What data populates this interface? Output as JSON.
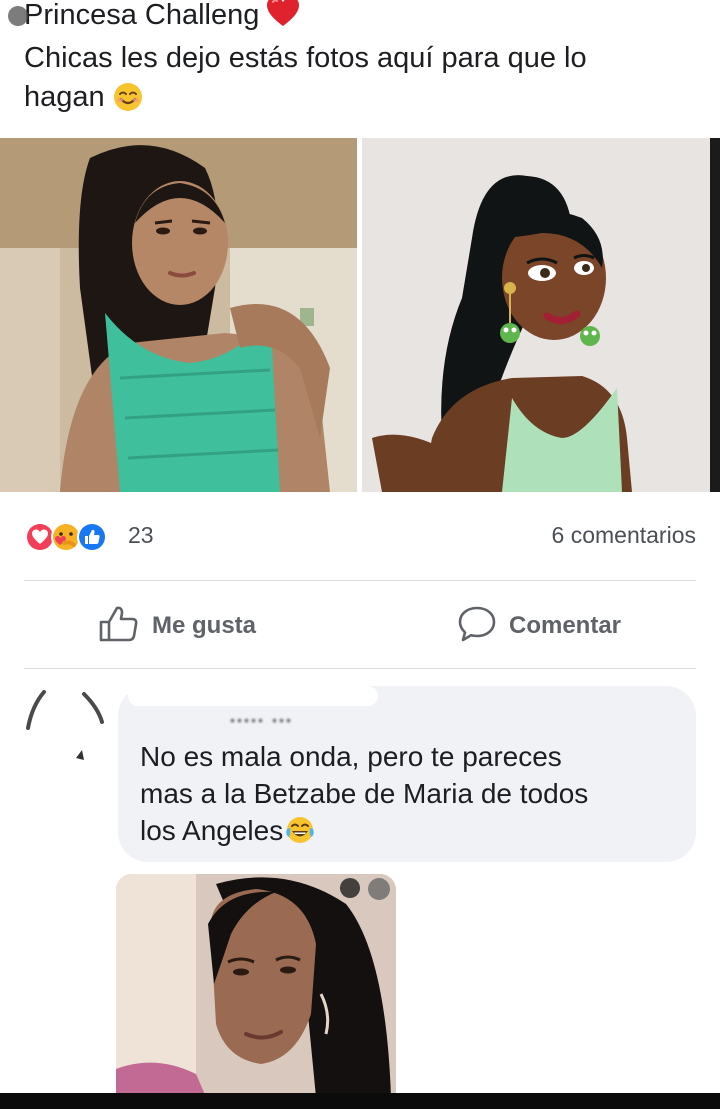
{
  "post": {
    "title_line": "Princesa Challeng",
    "title_emoji": "red-heart-icon",
    "body_line_1": "Chicas les dejo estás fotos aquí para que lo",
    "body_line_2": "hagan",
    "body_emoji": "smiling-face-icon"
  },
  "photos": {
    "left": "photo-real-girl",
    "right": "photo-cartoon-princess"
  },
  "reactions": {
    "icons": [
      "love-reaction-icon",
      "care-reaction-icon",
      "like-reaction-icon"
    ],
    "count": "23",
    "comments_label": "6 comentarios"
  },
  "actions": {
    "like_label": "Me gusta",
    "comment_label": "Comentar"
  },
  "comment": {
    "author": "..... ...",
    "line_1": "No es mala onda, pero te pareces",
    "line_2": "mas a la Betzabe de Maria de todos",
    "line_3": "los Angeles",
    "emoji": "tears-of-joy-icon"
  },
  "colors": {
    "like_blue": "#1877f2",
    "love_red": "#f33e58",
    "heart_red": "#e0212e",
    "bubble_gray": "#f0f2f5",
    "secondary_text": "#5f6368"
  }
}
